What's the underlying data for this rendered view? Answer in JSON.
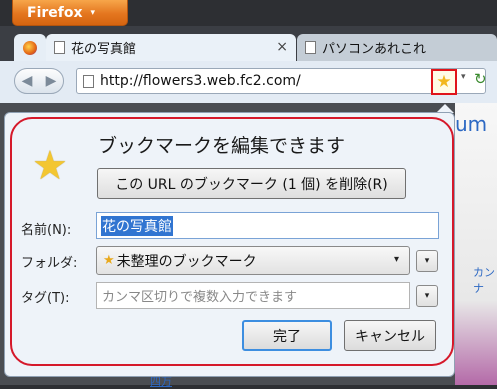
{
  "app": {
    "button_label": "Firefox",
    "button_arrow": "▾"
  },
  "tabs": [
    {
      "label": "花の写真館",
      "icon": "page-icon",
      "active": true,
      "close": "×"
    },
    {
      "label": "パソコンあれこれ",
      "icon": "page-icon",
      "active": false
    }
  ],
  "nav": {
    "back": "◀",
    "forward": "▶",
    "url": "http://flowers3.web.fc2.com/",
    "star": "★",
    "dropdown": "▾",
    "reload": "↻"
  },
  "page": {
    "right_text": "um",
    "right_link": "カンナ",
    "bottom_link": "四万"
  },
  "panel": {
    "star": "★",
    "title": "ブックマークを編集できます",
    "remove_button": "この URL のブックマーク (1 個) を削除(R)",
    "name_label": "名前(N):",
    "name_value": "花の写真館",
    "folder_label": "フォルダ:",
    "folder_value": "未整理のブックマーク",
    "folder_star": "★",
    "tags_label": "タグ(T):",
    "tags_placeholder": "カンマ区切りで複数入力できます",
    "expander": "▾",
    "select_arrow": "▾",
    "done_button": "完了",
    "cancel_button": "キャンセル"
  },
  "colors": {
    "highlight_outline": "#d5182a",
    "firefox_orange": "#e4761f",
    "selection": "#3175d1"
  }
}
